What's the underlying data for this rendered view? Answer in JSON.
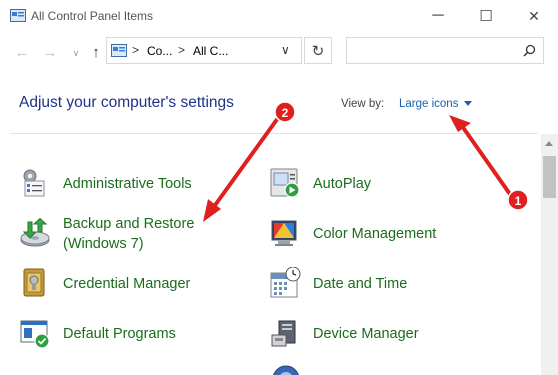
{
  "window": {
    "title": "All Control Panel Items",
    "minimize_glyph": "─",
    "maximize_glyph": "☐",
    "close_glyph": "✕"
  },
  "nav": {
    "back_glyph": "←",
    "forward_glyph": "→",
    "recent_glyph": "∨",
    "up_glyph": "↑",
    "address": {
      "separator": ">",
      "crumbs": [
        "Co...",
        "All C..."
      ],
      "dropdown_glyph": "∨"
    },
    "refresh_glyph": "↻",
    "search_placeholder": ""
  },
  "header": {
    "title": "Adjust your computer's settings",
    "view_by_label": "View by:",
    "view_by_value": "Large icons"
  },
  "items": [
    {
      "label": "Administrative Tools",
      "icon": "administrative-tools-icon"
    },
    {
      "label": "AutoPlay",
      "icon": "autoplay-icon"
    },
    {
      "label": "Backup and Restore",
      "label_line2": "(Windows 7)",
      "icon": "backup-restore-icon"
    },
    {
      "label": "Color Management",
      "icon": "color-management-icon"
    },
    {
      "label": "Credential Manager",
      "icon": "credential-manager-icon"
    },
    {
      "label": "Date and Time",
      "icon": "date-time-icon"
    },
    {
      "label": "Default Programs",
      "icon": "default-programs-icon"
    },
    {
      "label": "Device Manager",
      "icon": "device-manager-icon"
    }
  ],
  "annotations": [
    {
      "label": "1",
      "color": "#e02020"
    },
    {
      "label": "2",
      "color": "#e02020"
    }
  ],
  "colors": {
    "link_green": "#1a6d1a",
    "heading_blue": "#1e3287",
    "accent_blue": "#1a5fb4",
    "annotation_red": "#e02020"
  }
}
